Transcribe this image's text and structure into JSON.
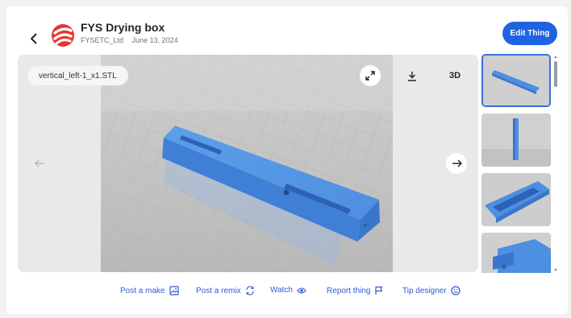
{
  "header": {
    "title": "FYS Drying box",
    "author": "FYSETC_Ltd",
    "date": "June 13, 2024",
    "edit_label": "Edit Thing",
    "accent": "#1f63e0",
    "brand_color": "#e8322e"
  },
  "viewer": {
    "file_name": "vertical_left-1_x1.STL",
    "view3d_label": "3D",
    "icons": [
      "expand-icon",
      "download-icon",
      "arrow-left-icon",
      "arrow-right-icon"
    ]
  },
  "thumbnails": [
    {
      "name": "thumbnail-1",
      "selected": true
    },
    {
      "name": "thumbnail-2",
      "selected": false
    },
    {
      "name": "thumbnail-3",
      "selected": false
    },
    {
      "name": "thumbnail-4",
      "selected": false
    }
  ],
  "actions": [
    {
      "label": "Post a make",
      "icon": "image-icon"
    },
    {
      "label": "Post a remix",
      "icon": "remix-icon"
    },
    {
      "label": "Watch",
      "icon": "eye-icon"
    },
    {
      "label": "Report thing",
      "icon": "flag-icon"
    },
    {
      "label": "Tip designer",
      "icon": "smile-icon"
    }
  ]
}
